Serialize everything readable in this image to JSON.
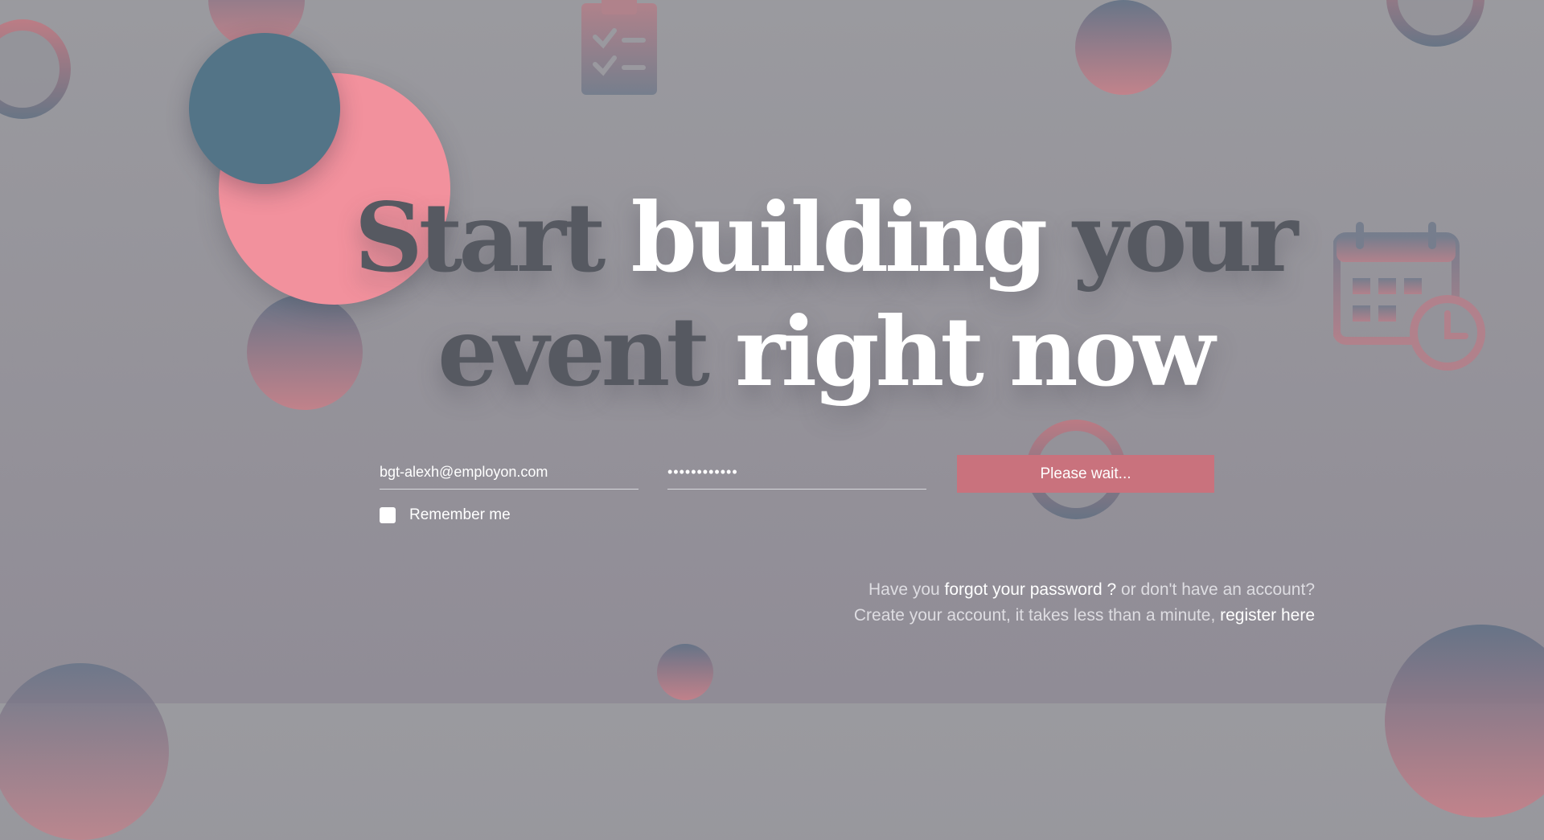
{
  "headline": {
    "line1": [
      {
        "text": "Start ",
        "tone": "dark"
      },
      {
        "text": "building ",
        "tone": "light"
      },
      {
        "text": "your",
        "tone": "dark"
      }
    ],
    "line2": [
      {
        "text": "event ",
        "tone": "dark"
      },
      {
        "text": "right now",
        "tone": "light"
      }
    ]
  },
  "login": {
    "email_value": "bgt-alexh@employon.com",
    "password_value": "••••••••••••",
    "submit_label": "Please wait...",
    "remember_label": "Remember me"
  },
  "help": {
    "line1_prefix": "Have you ",
    "forgot_link": "forgot your password ?",
    "line1_suffix": " or don't have an account?",
    "line2_prefix": "Create your account, it takes less than a minute, ",
    "register_link": "register here"
  },
  "icons": [
    "clipboard-check-icon",
    "calendar-clock-icon"
  ],
  "colors": {
    "accent_pink": "#f2919d",
    "accent_blue": "#537487",
    "button": "#c9727d",
    "headline_dark": "#565961",
    "headline_light": "#ffffff"
  }
}
